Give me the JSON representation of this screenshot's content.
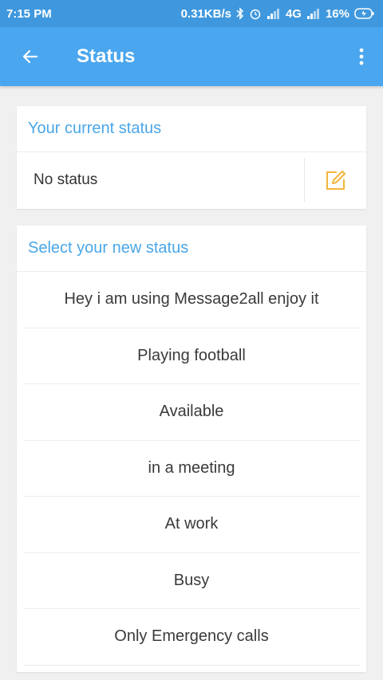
{
  "status_bar": {
    "time": "7:15 PM",
    "speed": "0.31KB/s",
    "network": "4G",
    "battery": "16%"
  },
  "app_bar": {
    "title": "Status"
  },
  "current_status": {
    "header": "Your current status",
    "value": "No status"
  },
  "new_status": {
    "header": "Select your new status",
    "items": [
      "Hey i am using Message2all enjoy it",
      "Playing football",
      "Available",
      "in a meeting",
      "At work",
      "Busy",
      "Only Emergency calls"
    ]
  },
  "colors": {
    "status_bar": "#3f98de",
    "app_bar": "#4aa6ee",
    "accent_text": "#4aa6e8",
    "edit_icon": "#f2b53a"
  }
}
